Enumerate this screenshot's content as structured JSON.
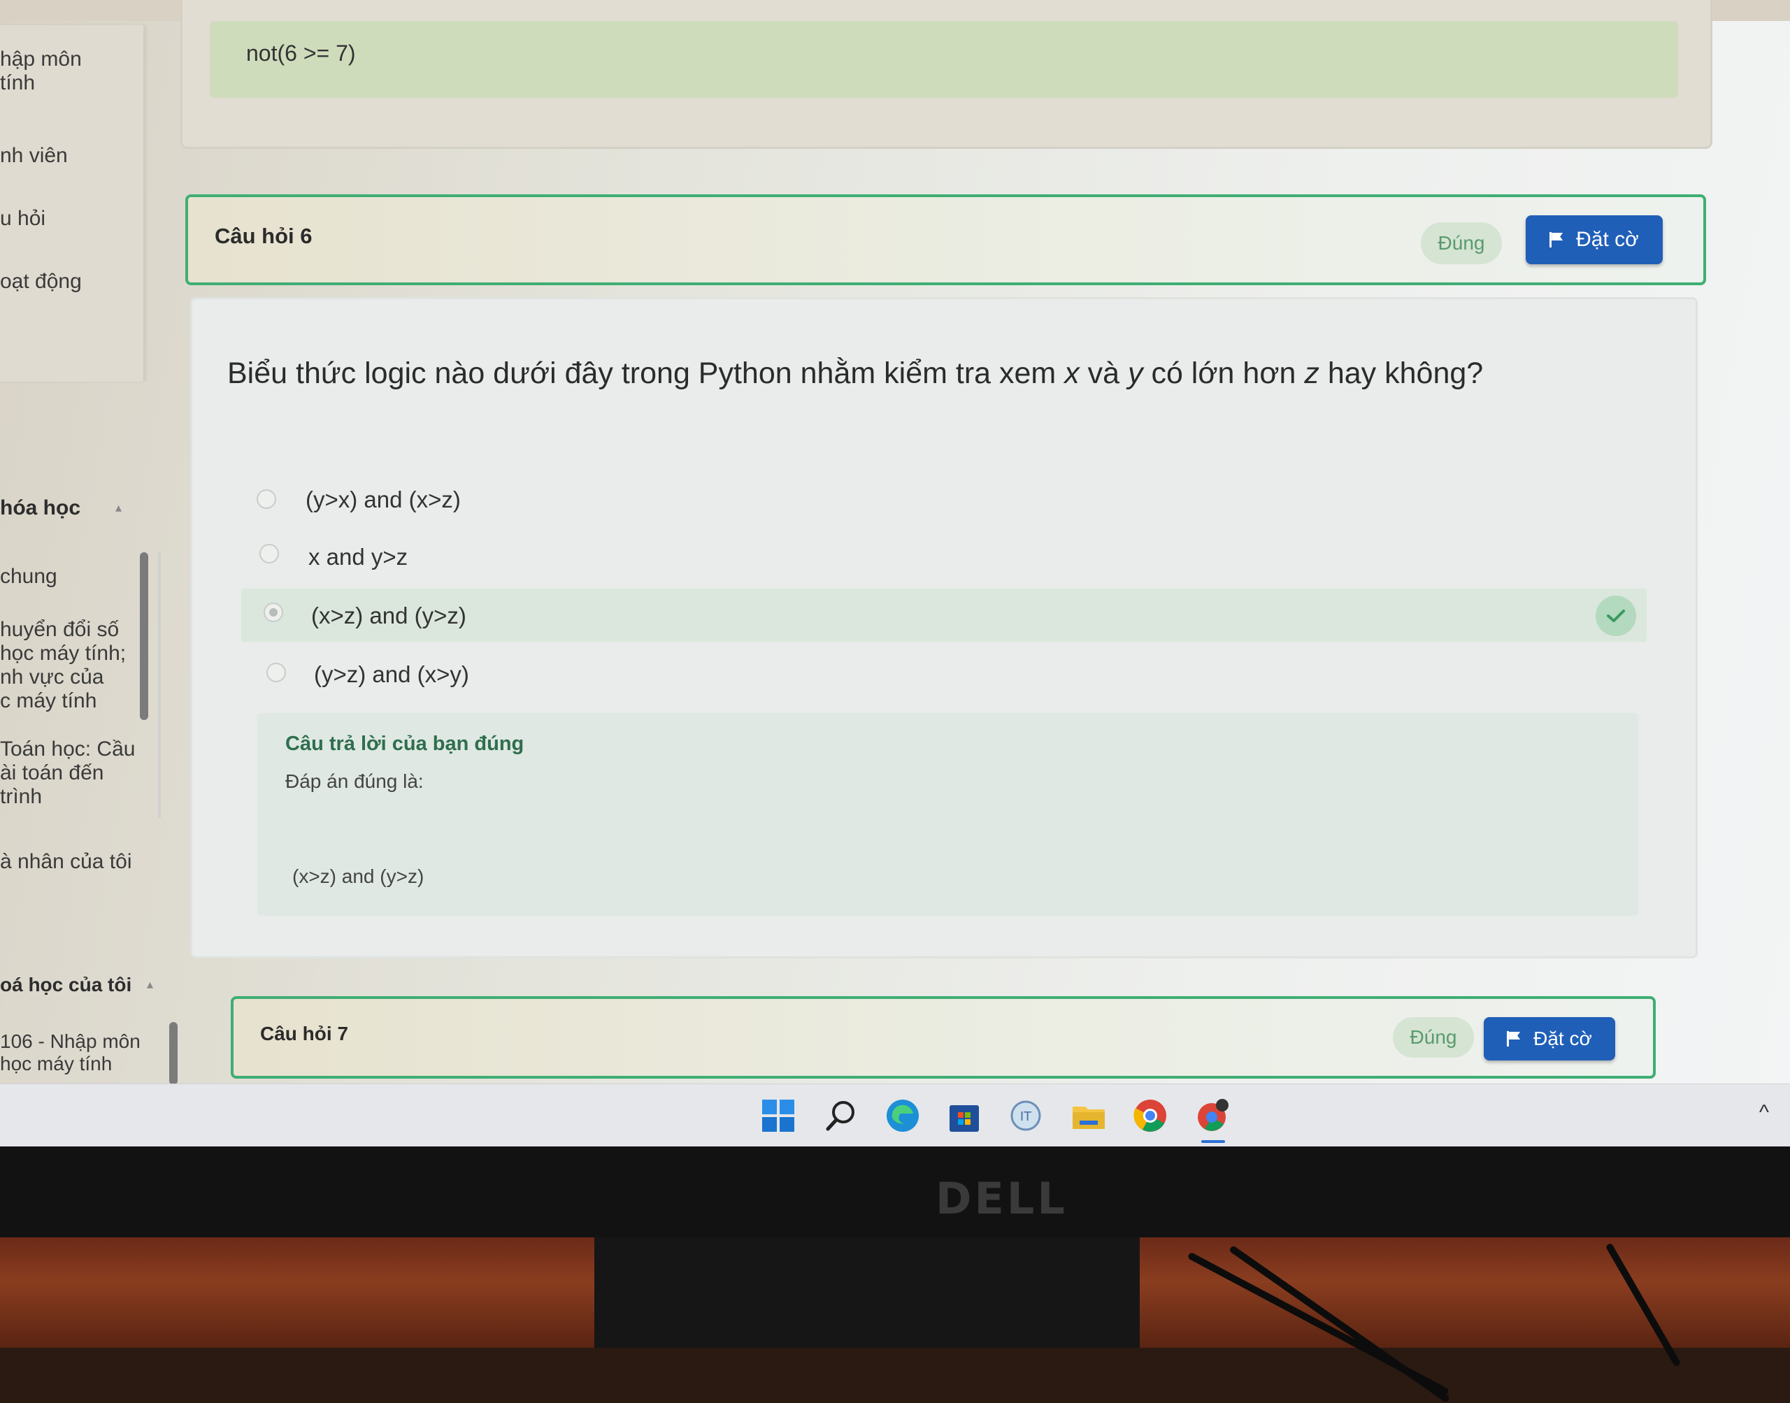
{
  "sidebar": {
    "upper_items": [
      "hập môn\ntính",
      "nh viên",
      "u hỏi",
      "oạt động"
    ],
    "course_header": "hóa học",
    "course_items": [
      "chung",
      "huyển đổi số\nhọc máy tính;\nnh vực của\nc máy tính",
      "Toán học: Cầu\nài toán đến\n trình"
    ],
    "personal": "à nhân của tôi",
    "my_courses_header": "oá học của tôi",
    "my_course_item": " 106 - Nhập môn\nhọc máy tính"
  },
  "previous": {
    "answer": "not(6 >= 7)"
  },
  "question6": {
    "title": "Câu hỏi 6",
    "status": "Đúng",
    "flag_label": "Đặt cờ",
    "text_before_x": "Biểu thức logic nào dưới đây trong Python nhằm kiểm tra xem ",
    "x": "x",
    "and_word": " và ",
    "y": "y",
    "mid": " có lớn hơn ",
    "z": "z",
    "end": " hay  không?",
    "options": [
      "(y>x) and (x>z)",
      "x and y>z",
      "(x>z) and (y>z)",
      "(y>z) and (x>y)"
    ],
    "selected_index": 2,
    "feedback_title": "Câu trả lời của bạn đúng",
    "feedback_sub": "Đáp án đúng là:",
    "feedback_answer": "(x>z) and (y>z)"
  },
  "question7": {
    "title": "Câu hỏi 7",
    "status": "Đúng",
    "flag_label": "Đặt cờ"
  },
  "taskbar": {
    "icons": [
      "windows-start-icon",
      "search-icon",
      "edge-icon",
      "store-icon",
      "it-app-icon",
      "file-explorer-icon",
      "chrome-icon",
      "chrome-profile-icon"
    ]
  },
  "monitor": {
    "brand": "DELL"
  },
  "colors": {
    "accent_green": "#3fae74",
    "flag_blue": "#1f5fb8",
    "correct_bg": "#dbe7dc"
  }
}
